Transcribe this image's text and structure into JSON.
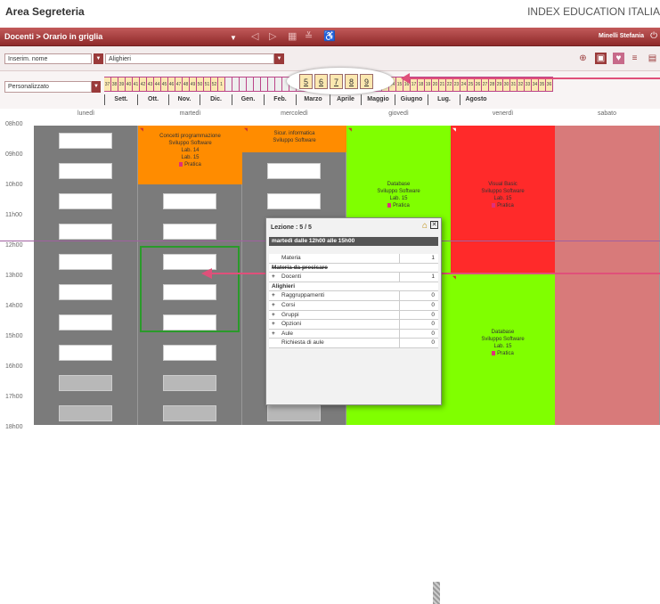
{
  "app_title": "Area Segreteria",
  "brand": "INDEX EDUCATION ITALIA",
  "titlebar": {
    "breadcrumb": "Docenti > Orario in griglia",
    "user": "Minelli Stefania"
  },
  "toolbar": {
    "field1": "Inserim. nome",
    "field2": "Alighieri"
  },
  "view_combo": "Personalizzato",
  "weeks_left": [
    "37",
    "38",
    "39",
    "40",
    "41",
    "42",
    "43",
    "44",
    "45",
    "46",
    "47",
    "48",
    "49",
    "50",
    "51",
    "52",
    "1"
  ],
  "zoom_weeks": [
    "5",
    "6",
    "7",
    "8",
    "9"
  ],
  "weeks_right": [
    "13",
    "14",
    "15",
    "16",
    "17",
    "18",
    "19",
    "20",
    "21",
    "22",
    "23",
    "24",
    "25",
    "26",
    "27",
    "28",
    "29",
    "30",
    "31",
    "32",
    "33",
    "34",
    "35",
    "36"
  ],
  "months": [
    "Sett.",
    "Ott.",
    "Nov.",
    "Dic.",
    "Gen.",
    "Feb.",
    "Marzo",
    "Aprile",
    "Maggio",
    "Giugno",
    "Lug.",
    "Agosto"
  ],
  "days": [
    "lunedì",
    "martedì",
    "mercoledì",
    "giovedì",
    "venerdì",
    "sabato"
  ],
  "hours": [
    "08h00",
    "09h00",
    "10h00",
    "11h00",
    "12h00",
    "13h00",
    "14h00",
    "15h00",
    "16h00",
    "17h00",
    "18h00"
  ],
  "lessons": {
    "tue": {
      "line1": "Concetti programmazione",
      "line2": "Sviluppo Software",
      "line3": "Lab. 14",
      "line4": "Lab. 15",
      "tag": "Pratica"
    },
    "wed": {
      "line1": "Sicur. informatica",
      "line2": "Sviluppo Software"
    },
    "thu": {
      "line1": "Database",
      "line2": "Sviluppo Software",
      "line3": "Lab. 15",
      "tag": "Pratica"
    },
    "fri1": {
      "line1": "Visual Basic",
      "line2": "Sviluppo Software",
      "line3": "Lab. 15",
      "tag": "Pratica"
    },
    "fri2": {
      "line1": "Database",
      "line2": "Sviluppo Software",
      "line3": "Lab. 15",
      "tag": "Pratica"
    }
  },
  "popup": {
    "title": "Lezione : 5 / 5",
    "subtitle": "martedì dalle 12h00 alle 15h00",
    "rows": [
      {
        "label": "Materia",
        "count": "1",
        "kind": "head"
      },
      {
        "label": "Materia da precisare",
        "count": "",
        "kind": "strike"
      },
      {
        "label": "Docenti",
        "count": "1",
        "kind": "plus"
      },
      {
        "label": "Alighieri",
        "count": "",
        "kind": "plain"
      },
      {
        "label": "Raggruppamenti",
        "count": "0",
        "kind": "plus"
      },
      {
        "label": "Corsi",
        "count": "0",
        "kind": "plus"
      },
      {
        "label": "Gruppi",
        "count": "0",
        "kind": "plus"
      },
      {
        "label": "Opzioni",
        "count": "0",
        "kind": "plus"
      },
      {
        "label": "Aule",
        "count": "0",
        "kind": "plus"
      },
      {
        "label": "Richiesta di aule",
        "count": "0",
        "kind": "head"
      }
    ]
  },
  "colors": {
    "accent": "#9a3a3a",
    "orange": "#ff8c00",
    "green": "#80ff00",
    "red": "#ff2a2a",
    "saturday": "#d87a7a"
  }
}
